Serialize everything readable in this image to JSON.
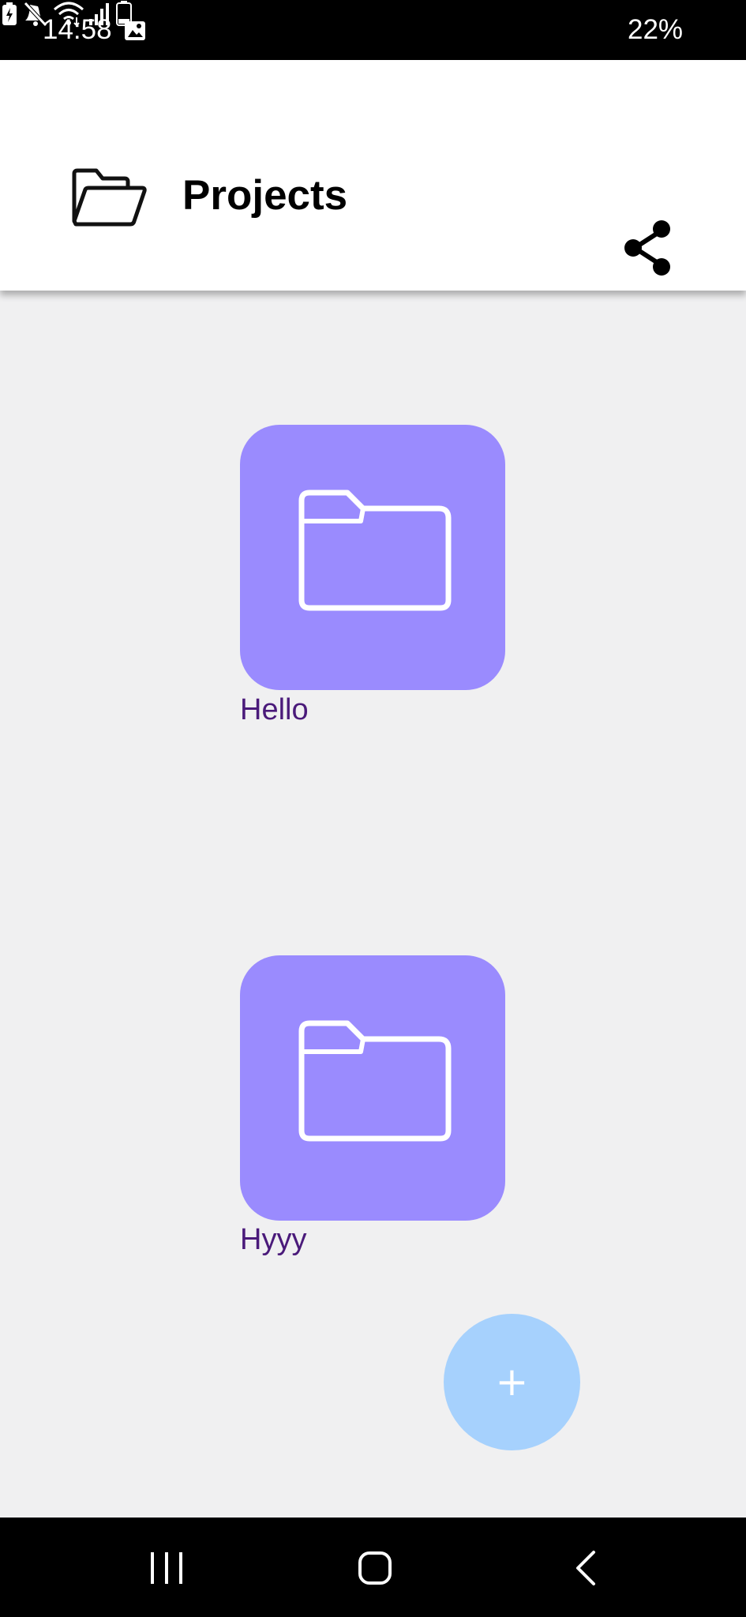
{
  "status_bar": {
    "time": "14:58",
    "battery_percent": "22%",
    "icons": [
      "gallery-icon",
      "battery-saver-icon",
      "mute-icon",
      "wifi-icon",
      "signal-icon",
      "battery-icon"
    ]
  },
  "app_bar": {
    "title": "Projects",
    "leading_icon": "folder-open-icon",
    "action_icon": "share-icon"
  },
  "projects": [
    {
      "name": "Hello",
      "icon": "folder-icon"
    },
    {
      "name": "Hyyy",
      "icon": "folder-icon"
    }
  ],
  "fab": {
    "label": "+"
  },
  "nav_bar": {
    "buttons": [
      "recent-apps",
      "home",
      "back"
    ]
  },
  "colors": {
    "tile": "#9a8bfe",
    "label": "#4a1a7a",
    "fab": "#a6d1fd",
    "background": "#f0f0f1"
  }
}
